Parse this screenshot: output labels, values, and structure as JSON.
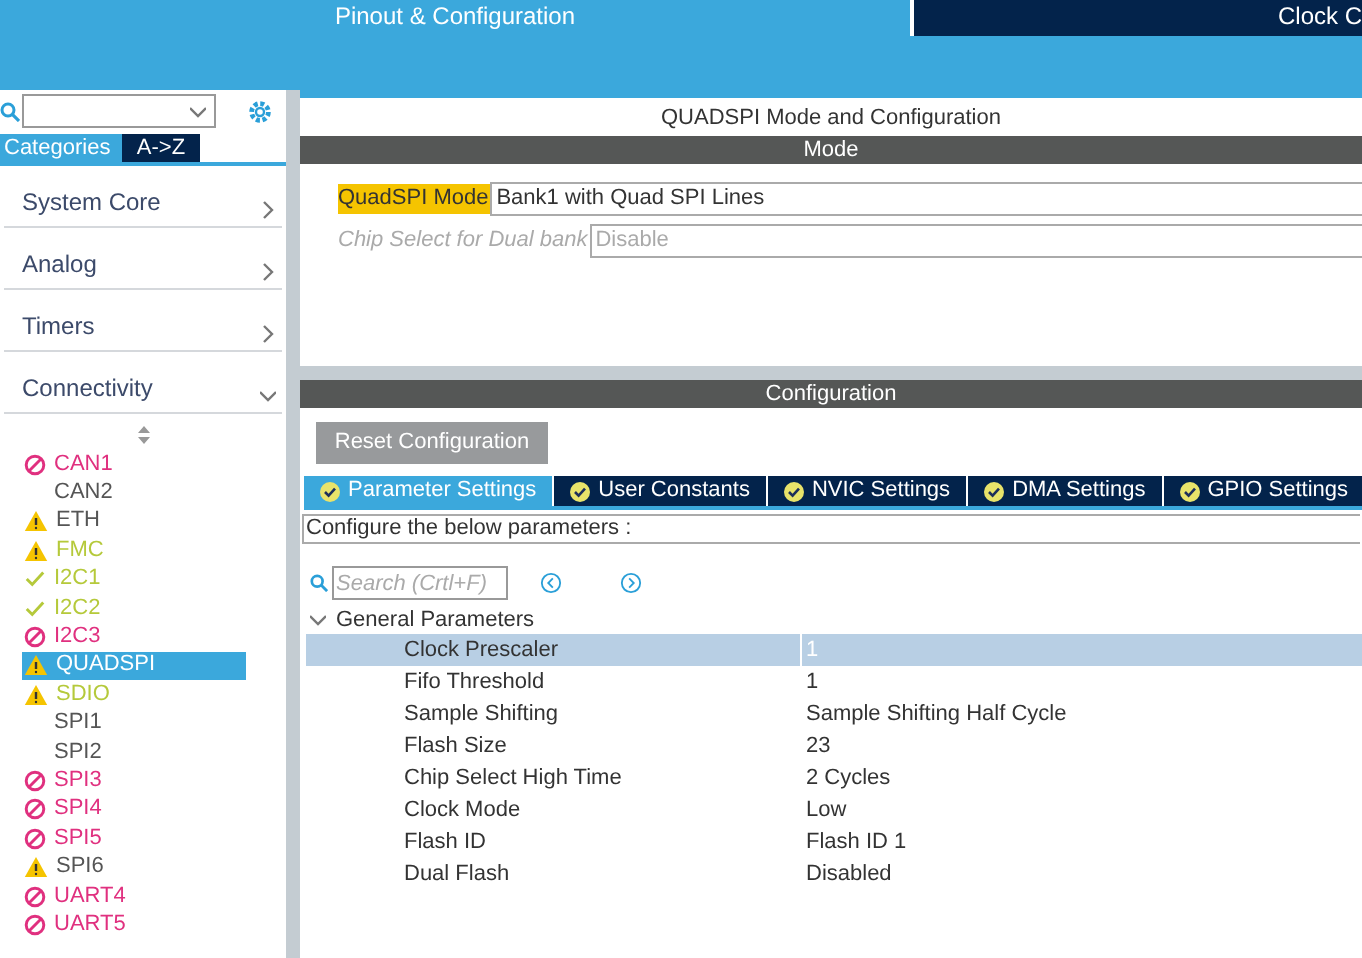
{
  "top_tabs": [
    {
      "label": "Pinout & Configuration",
      "selected": true
    },
    {
      "label": "Clock C",
      "selected": false
    }
  ],
  "sidebar": {
    "view_tabs": [
      {
        "label": "Categories",
        "selected": true
      },
      {
        "label": "A->Z",
        "selected": false
      }
    ],
    "categories": [
      {
        "label": "System Core",
        "expanded": false
      },
      {
        "label": "Analog",
        "expanded": false
      },
      {
        "label": "Timers",
        "expanded": false
      },
      {
        "label": "Connectivity",
        "expanded": true
      }
    ],
    "peripherals": [
      {
        "label": "CAN1",
        "kind": "blocked",
        "configured": false,
        "selected": false
      },
      {
        "label": "CAN2",
        "kind": "none",
        "configured": false,
        "selected": false
      },
      {
        "label": "ETH",
        "kind": "warning",
        "configured": false,
        "selected": false
      },
      {
        "label": "FMC",
        "kind": "warning",
        "configured": true,
        "selected": false
      },
      {
        "label": "I2C1",
        "kind": "check",
        "configured": true,
        "selected": false
      },
      {
        "label": "I2C2",
        "kind": "check",
        "configured": true,
        "selected": false
      },
      {
        "label": "I2C3",
        "kind": "blocked",
        "configured": false,
        "selected": false
      },
      {
        "label": "QUADSPI",
        "kind": "warning",
        "configured": false,
        "selected": true
      },
      {
        "label": "SDIO",
        "kind": "warning",
        "configured": true,
        "selected": false
      },
      {
        "label": "SPI1",
        "kind": "none",
        "configured": false,
        "selected": false
      },
      {
        "label": "SPI2",
        "kind": "none",
        "configured": false,
        "selected": false
      },
      {
        "label": "SPI3",
        "kind": "blocked",
        "configured": false,
        "selected": false
      },
      {
        "label": "SPI4",
        "kind": "blocked",
        "configured": false,
        "selected": false
      },
      {
        "label": "SPI5",
        "kind": "blocked",
        "configured": false,
        "selected": false
      },
      {
        "label": "SPI6",
        "kind": "warning",
        "configured": false,
        "selected": false
      },
      {
        "label": "UART4",
        "kind": "blocked",
        "configured": false,
        "selected": false
      },
      {
        "label": "UART5",
        "kind": "blocked",
        "configured": false,
        "selected": false
      }
    ]
  },
  "main": {
    "title": "QUADSPI Mode and Configuration",
    "mode": {
      "header": "Mode",
      "fields": [
        {
          "label": "QuadSPI Mode",
          "value": "Bank1 with Quad SPI Lines",
          "disabled": false
        },
        {
          "label": "Chip Select for Dual bank",
          "value": "Disable",
          "disabled": true
        }
      ]
    },
    "configuration": {
      "header": "Configuration",
      "reset_button": "Reset Configuration",
      "tabs": [
        {
          "label": "Parameter Settings",
          "selected": true
        },
        {
          "label": "User Constants",
          "selected": false
        },
        {
          "label": "NVIC Settings",
          "selected": false
        },
        {
          "label": "DMA Settings",
          "selected": false
        },
        {
          "label": "GPIO Settings",
          "selected": false
        }
      ],
      "hint": "Configure the below parameters :",
      "search": {
        "placeholder": "Search (Crtl+F)"
      },
      "group": {
        "label": "General Parameters",
        "expanded": true,
        "rows": [
          {
            "name": "Clock Prescaler",
            "value": "1",
            "selected": true
          },
          {
            "name": "Fifo Threshold",
            "value": "1",
            "selected": false
          },
          {
            "name": "Sample Shifting",
            "value": "Sample Shifting Half Cycle",
            "selected": false
          },
          {
            "name": "Flash Size",
            "value": "23",
            "selected": false
          },
          {
            "name": "Chip Select High Time",
            "value": "2 Cycles",
            "selected": false
          },
          {
            "name": "Clock Mode",
            "value": "Low",
            "selected": false
          },
          {
            "name": "Flash ID",
            "value": "Flash ID 1",
            "selected": false
          },
          {
            "name": "Dual Flash",
            "value": "Disabled",
            "selected": false
          }
        ]
      }
    }
  }
}
